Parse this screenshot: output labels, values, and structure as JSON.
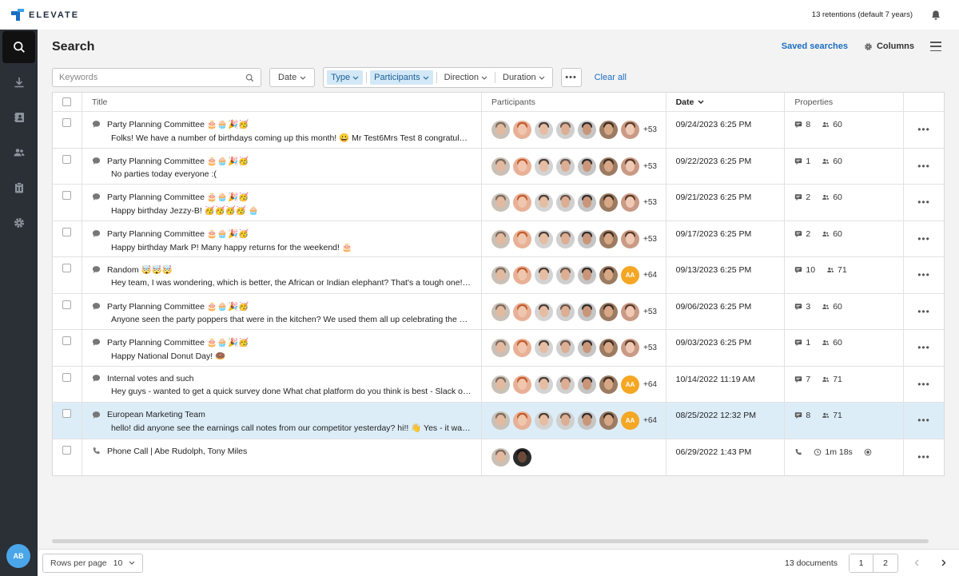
{
  "app": {
    "brand": "ELEVATE",
    "retention": "13 retentions (default 7 years)"
  },
  "user": {
    "initials": "AB"
  },
  "page": {
    "title": "Search",
    "saved_searches": "Saved searches",
    "columns": "Columns"
  },
  "toolbar": {
    "search_placeholder": "Keywords",
    "date": "Date",
    "type": "Type",
    "participants": "Participants",
    "direction": "Direction",
    "duration": "Duration",
    "more": "•••",
    "clear_all": "Clear all"
  },
  "columns": {
    "title": "Title",
    "participants": "Participants",
    "date": "Date",
    "properties": "Properties"
  },
  "rows": [
    {
      "title": "Party Planning Committee 🎂🧁🎉🥳",
      "snippet": "Folks! We have a number of birthdays coming up this month! 😀 Mr Test6Mrs Test 8 congratulations to you both! 🎉",
      "more": "+53",
      "date": "09/24/2023 6:25 PM",
      "messages": "8",
      "people": "60"
    },
    {
      "title": "Party Planning Committee 🎂🧁🎉🥳",
      "snippet": "No parties today everyone :(",
      "more": "+53",
      "date": "09/22/2023 6:25 PM",
      "messages": "1",
      "people": "60"
    },
    {
      "title": "Party Planning Committee 🎂🧁🎉🥳",
      "snippet": "Happy birthday Jezzy-B! 🥳🥳🥳🥳 🧁",
      "more": "+53",
      "date": "09/21/2023 6:25 PM",
      "messages": "2",
      "people": "60"
    },
    {
      "title": "Party Planning Committee 🎂🧁🎉🥳",
      "snippet": "Happy birthday Mark P! Many happy returns for the weekend! 🎂",
      "more": "+53",
      "date": "09/17/2023 6:25 PM",
      "messages": "2",
      "people": "60"
    },
    {
      "title": "Random 🤯🤯🤯",
      "snippet": "Hey team, I was wondering, which is better, the African or Indian elephant? That's a tough one! It depends",
      "more": "+64",
      "date": "09/13/2023 6:25 PM",
      "messages": "10",
      "people": "71",
      "initials": "AA"
    },
    {
      "title": "Party Planning Committee 🎂🧁🎉🥳",
      "snippet": "Anyone seen the party poppers that were in the kitchen? We used them all up celebrating the new office",
      "more": "+53",
      "date": "09/06/2023 6:25 PM",
      "messages": "3",
      "people": "60"
    },
    {
      "title": "Party Planning Committee 🎂🧁🎉🥳",
      "snippet": "Happy National Donut Day! 🍩",
      "more": "+53",
      "date": "09/03/2023 6:25 PM",
      "messages": "1",
      "people": "60"
    },
    {
      "title": "Internal votes and such",
      "snippet": "Hey guys - wanted to get a quick survey done What chat platform do you think is best - Slack or MS Teams?",
      "more": "+64",
      "date": "10/14/2022 11:19 AM",
      "messages": "7",
      "people": "71",
      "initials": "AA"
    },
    {
      "title": "European Marketing Team",
      "snippet": "hello! did anyone see the earnings call notes from our competitor yesterday? hi!! 👋 Yes - it was interesting",
      "more": "+64",
      "date": "08/25/2022 12:32 PM",
      "messages": "8",
      "people": "71",
      "initials": "AA"
    },
    {
      "title": "Phone Call | Abe Rudolph, Tony Miles",
      "snippet": "",
      "date": "06/29/2022 1:43 PM",
      "duration": "1m 18s"
    }
  ],
  "footer": {
    "rows_per_page_label": "Rows per page",
    "rows_per_page": "10",
    "documents": "13 documents",
    "page1": "1",
    "page2": "2"
  },
  "colors": {
    "accent": "#1b6ec2",
    "selected_row": "#dcedf8",
    "sidebar": "#2b2f36",
    "initials_badge": "#f5a623"
  }
}
